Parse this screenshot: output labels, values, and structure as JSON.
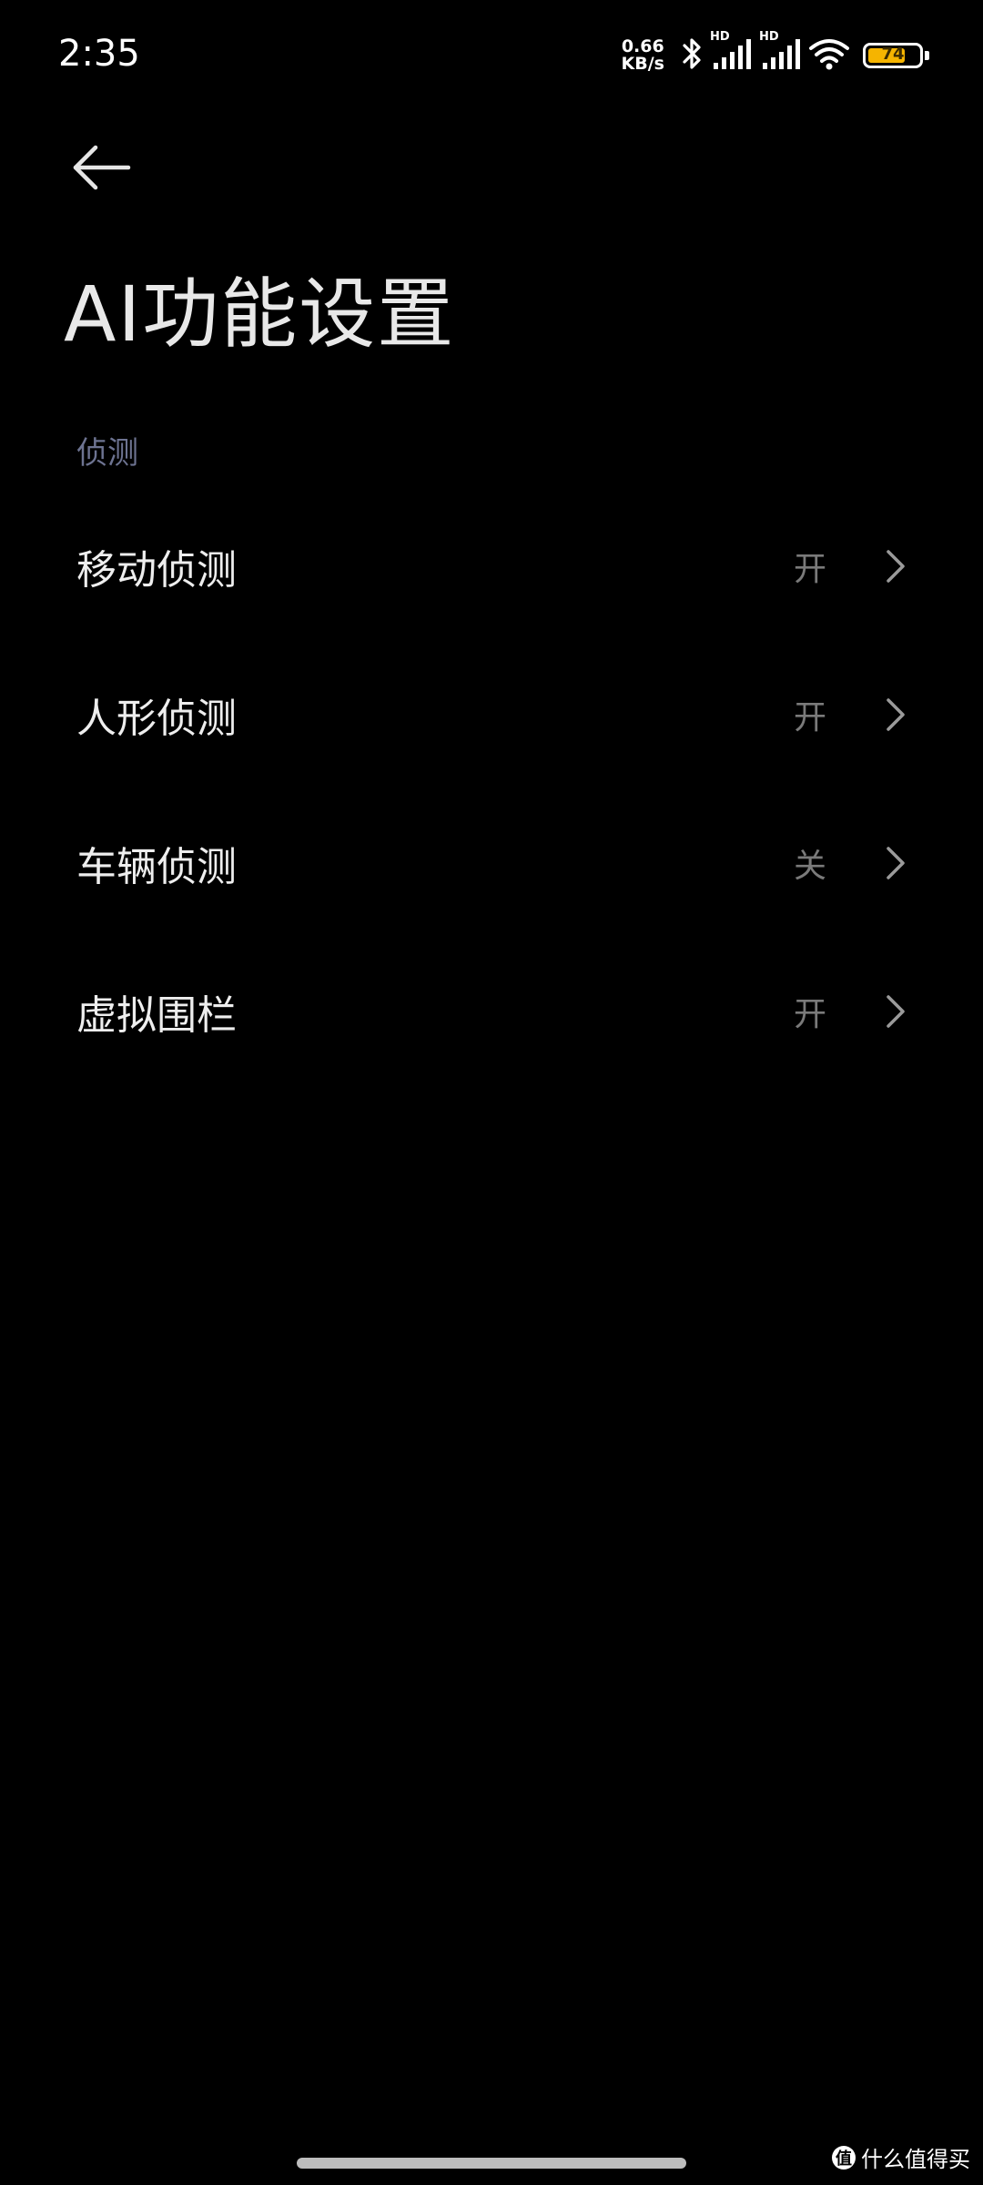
{
  "status_bar": {
    "time": "2:35",
    "net_speed_value": "0.66",
    "net_speed_unit": "KB/s",
    "signal1_label": "HD",
    "signal2_label": "HD",
    "battery_level": "74",
    "battery_fraction": 0.74,
    "battery_color": "#f5b400"
  },
  "header": {
    "back_icon": "arrow-left-icon",
    "title": "AI功能设置"
  },
  "section": {
    "title": "侦测"
  },
  "items": [
    {
      "label": "移动侦测",
      "value": "开"
    },
    {
      "label": "人形侦测",
      "value": "开"
    },
    {
      "label": "车辆侦测",
      "value": "关"
    },
    {
      "label": "虚拟围栏",
      "value": "开"
    }
  ],
  "watermark": {
    "badge": "值",
    "text": "什么值得买"
  },
  "colors": {
    "background": "#000000",
    "section_header": "#6d7391",
    "value_text": "#7a7a7a"
  }
}
